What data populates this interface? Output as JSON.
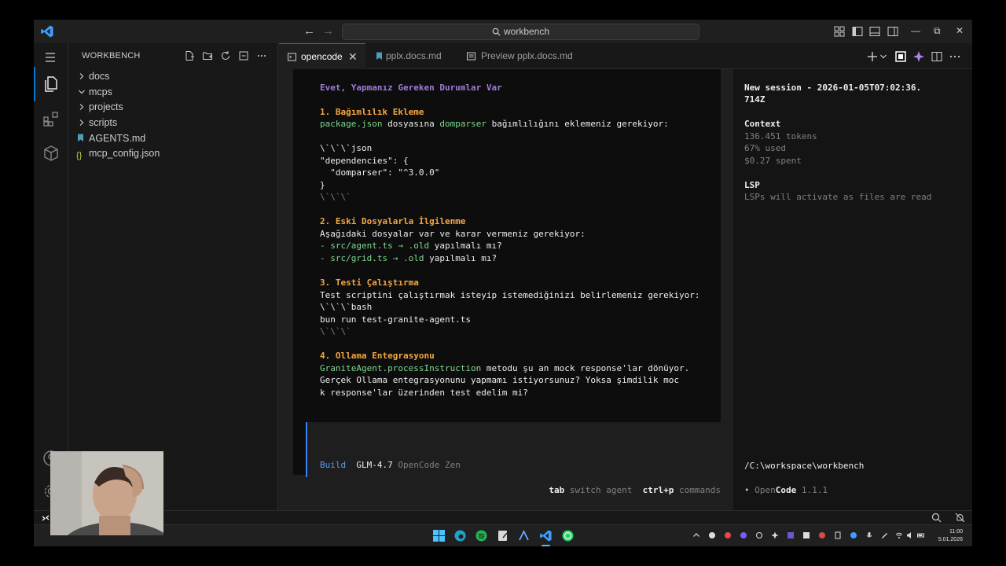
{
  "titlebar": {
    "search_text": "workbench",
    "back_arrow": "←",
    "forward_arrow": "→",
    "minimize": "—",
    "restore": "⧉",
    "close": "✕"
  },
  "sidebar": {
    "header": "WORKBENCH",
    "items": [
      {
        "label": "docs",
        "type": "folder"
      },
      {
        "label": "mcps",
        "type": "folder"
      },
      {
        "label": "projects",
        "type": "folder"
      },
      {
        "label": "scripts",
        "type": "folder"
      },
      {
        "label": "AGENTS.md",
        "type": "file"
      },
      {
        "label": "mcp_config.json",
        "type": "file"
      }
    ]
  },
  "tabs": [
    {
      "label": "opencode",
      "active": true
    },
    {
      "label": "pplx.docs.md",
      "active": false
    },
    {
      "label": "Preview pplx.docs.md",
      "active": false
    }
  ],
  "terminal": {
    "heading": "Evet, Yapmanız Gereken Durumlar Var",
    "s1_title": "1. Bağımlılık Ekleme",
    "s1_line_code": "package.json",
    "s1_line_mid": " dosyasına ",
    "s1_line_code2": "domparser",
    "s1_line_end": " bağımlılığını eklemeniz gerekiyor:",
    "s1_fence_open": "\\`\\`\\`json",
    "s1_json1": "\"dependencies\": {",
    "s1_json2": "  \"domparser\": \"^3.0.0\"",
    "s1_json3": "}",
    "s1_fence_close": "\\`\\`\\`",
    "s2_title": "2. Eski Dosyalarla İlgilenme",
    "s2_intro": "Aşağıdaki dosyalar var ve karar vermeniz gerekiyor:",
    "s2_item1_code": "- src/agent.ts → .old",
    "s2_item1_end": " yapılmalı mı?",
    "s2_item2_code": "- src/grid.ts → .old",
    "s2_item2_end": " yapılmalı mı?",
    "s3_title": "3. Testi Çalıştırma",
    "s3_intro": "Test scriptini çalıştırmak isteyip istemediğinizi belirlemeniz gerekiyor:",
    "s3_fence_open": "\\`\\`\\`bash",
    "s3_cmd": "bun run test-granite-agent.ts",
    "s3_fence_close": "\\`\\`\\`",
    "s4_title": "4. Ollama Entegrasyonu",
    "s4_code": "GraniteAgent.processInstruction",
    "s4_line1_end": " metodu şu an mock response'lar dönüyor.",
    "s4_line2": "Gerçek Ollama entegrasyonunu yapmamı istiyorsunuz? Yoksa şimdilik moc",
    "s4_line3": "k response'lar üzerinden test edelim mi?"
  },
  "input": {
    "mode": "Build",
    "model": "GLM-4.7",
    "provider": "OpenCode Zen"
  },
  "statusline": {
    "key1": "tab",
    "label1": "switch agent",
    "key2": "ctrl+p",
    "label2": "commands"
  },
  "session": {
    "title_line1": "New session - 2026-01-05T07:02:36.",
    "title_line2": "714Z",
    "context_heading": "Context",
    "tokens": "136.451 tokens",
    "used": "67% used",
    "spent": "$0.27 spent",
    "lsp_heading": "LSP",
    "lsp_text": "LSPs will activate as files are read",
    "path": "/C:\\workspace\\workbench",
    "version_bullet": "•",
    "version_open": "Open",
    "version_code": "Code",
    "version_number": "1.1.1"
  },
  "clock": {
    "time": "11:00",
    "date": "5.01.2026"
  },
  "colors": {
    "accent": "#0078d4",
    "heading_orange": "#f5a742",
    "title_purple": "#9d7cd8",
    "code_green": "#7fd88f"
  }
}
